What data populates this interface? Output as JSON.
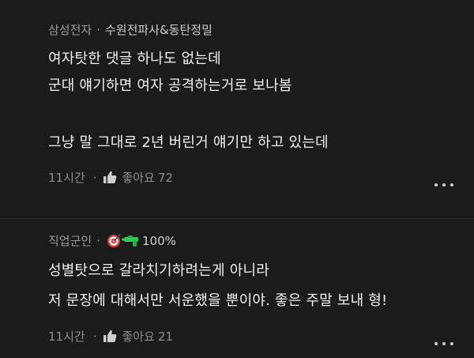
{
  "comments": [
    {
      "company": "삼성전자",
      "department": "수원전파사&동탄정밀",
      "lines": [
        "여자탓한 댓글 하나도 없는데",
        "군대 얘기하면 여자 공격하는거로 보나봄",
        "",
        "그냥 말 그대로 2년 버린거 얘기만 하고 있는데"
      ],
      "time": "11시간",
      "like_label": "좋아요",
      "like_count": "72"
    },
    {
      "company": "직업군인",
      "badge_icons": [
        "target-icon",
        "water-gun-icon"
      ],
      "badge_percent": "100%",
      "lines": [
        "성별탓으로 갈라치기하려는게 아니라",
        "저 문장에 대해서만 서운했을 뿐이야. 좋은 주말 보내 형!"
      ],
      "time": "11시간",
      "like_label": "좋아요",
      "like_count": "21"
    }
  ],
  "separator": "·",
  "colors": {
    "background": "#1b1b1b",
    "text_primary": "#f0f0f0",
    "text_muted": "#9a9a9a"
  }
}
